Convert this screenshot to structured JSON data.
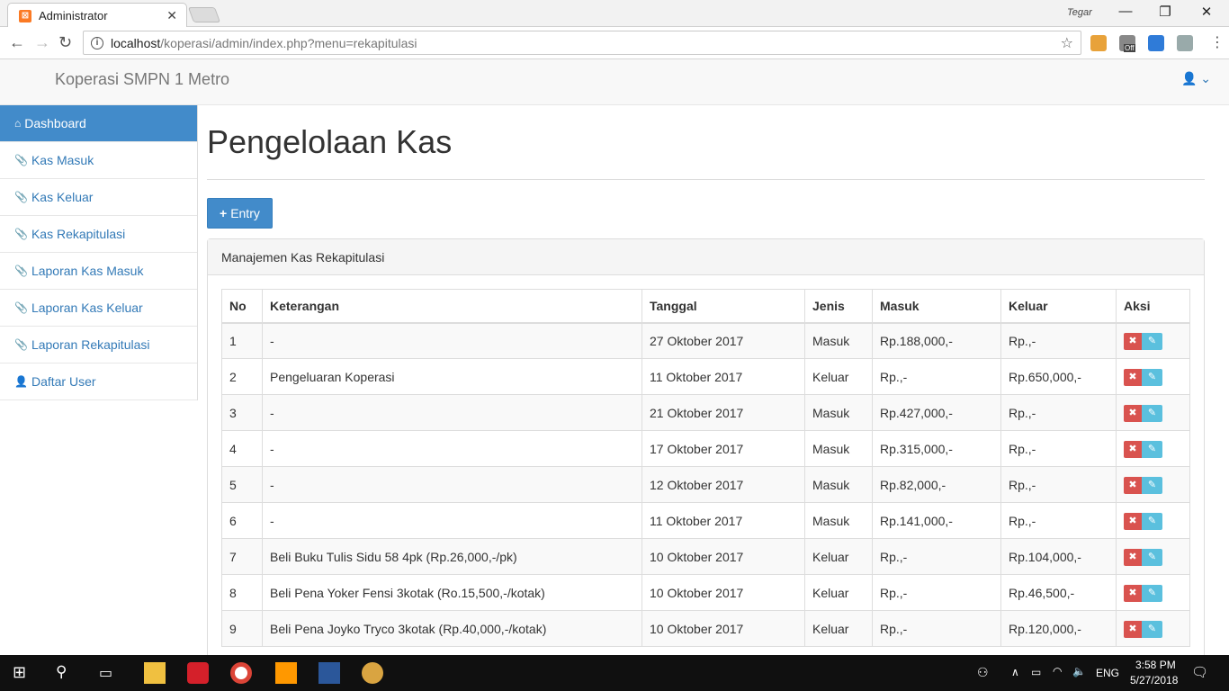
{
  "browser": {
    "tab_title": "Administrator",
    "tab_close": "✕",
    "window_user": "Tegar",
    "url_host": "localhost",
    "url_path": "/koperasi/admin/index.php?menu=rekapitulasi",
    "ext_badge": "Off"
  },
  "app": {
    "brand": "Koperasi SMPN 1 Metro",
    "sidebar": [
      {
        "label": "Dashboard",
        "icon": "home-icon"
      },
      {
        "label": "Kas Masuk",
        "icon": "paperclip-icon"
      },
      {
        "label": "Kas Keluar",
        "icon": "paperclip-icon"
      },
      {
        "label": "Kas Rekapitulasi",
        "icon": "paperclip-icon"
      },
      {
        "label": "Laporan Kas Masuk",
        "icon": "paperclip-icon"
      },
      {
        "label": "Laporan Kas Keluar",
        "icon": "paperclip-icon"
      },
      {
        "label": "Laporan Rekapitulasi",
        "icon": "paperclip-icon"
      },
      {
        "label": "Daftar User",
        "icon": "user-icon"
      }
    ],
    "page_title": "Pengelolaan Kas",
    "entry_label": "Entry",
    "panel_title": "Manajemen Kas Rekapitulasi",
    "table": {
      "headers": [
        "No",
        "Keterangan",
        "Tanggal",
        "Jenis",
        "Masuk",
        "Keluar",
        "Aksi"
      ],
      "rows": [
        [
          "1",
          "-",
          "27 Oktober 2017",
          "Masuk",
          "Rp.188,000,-",
          "Rp.,-"
        ],
        [
          "2",
          "Pengeluaran Koperasi",
          "11 Oktober 2017",
          "Keluar",
          "Rp.,-",
          "Rp.650,000,-"
        ],
        [
          "3",
          "-",
          "21 Oktober 2017",
          "Masuk",
          "Rp.427,000,-",
          "Rp.,-"
        ],
        [
          "4",
          "-",
          "17 Oktober 2017",
          "Masuk",
          "Rp.315,000,-",
          "Rp.,-"
        ],
        [
          "5",
          "-",
          "12 Oktober 2017",
          "Masuk",
          "Rp.82,000,-",
          "Rp.,-"
        ],
        [
          "6",
          "-",
          "11 Oktober 2017",
          "Masuk",
          "Rp.141,000,-",
          "Rp.,-"
        ],
        [
          "7",
          "Beli Buku Tulis Sidu 58 4pk (Rp.26,000,-/pk)",
          "10 Oktober 2017",
          "Keluar",
          "Rp.,-",
          "Rp.104,000,-"
        ],
        [
          "8",
          "Beli Pena Yoker Fensi 3kotak (Ro.15,500,-/kotak)",
          "10 Oktober 2017",
          "Keluar",
          "Rp.,-",
          "Rp.46,500,-"
        ],
        [
          "9",
          "Beli Pena Joyko Tryco 3kotak (Rp.40,000,-/kotak)",
          "10 Oktober 2017",
          "Keluar",
          "Rp.,-",
          "Rp.120,000,-"
        ]
      ]
    }
  },
  "taskbar": {
    "lang": "ENG",
    "time": "3:58 PM",
    "date": "5/27/2018"
  }
}
